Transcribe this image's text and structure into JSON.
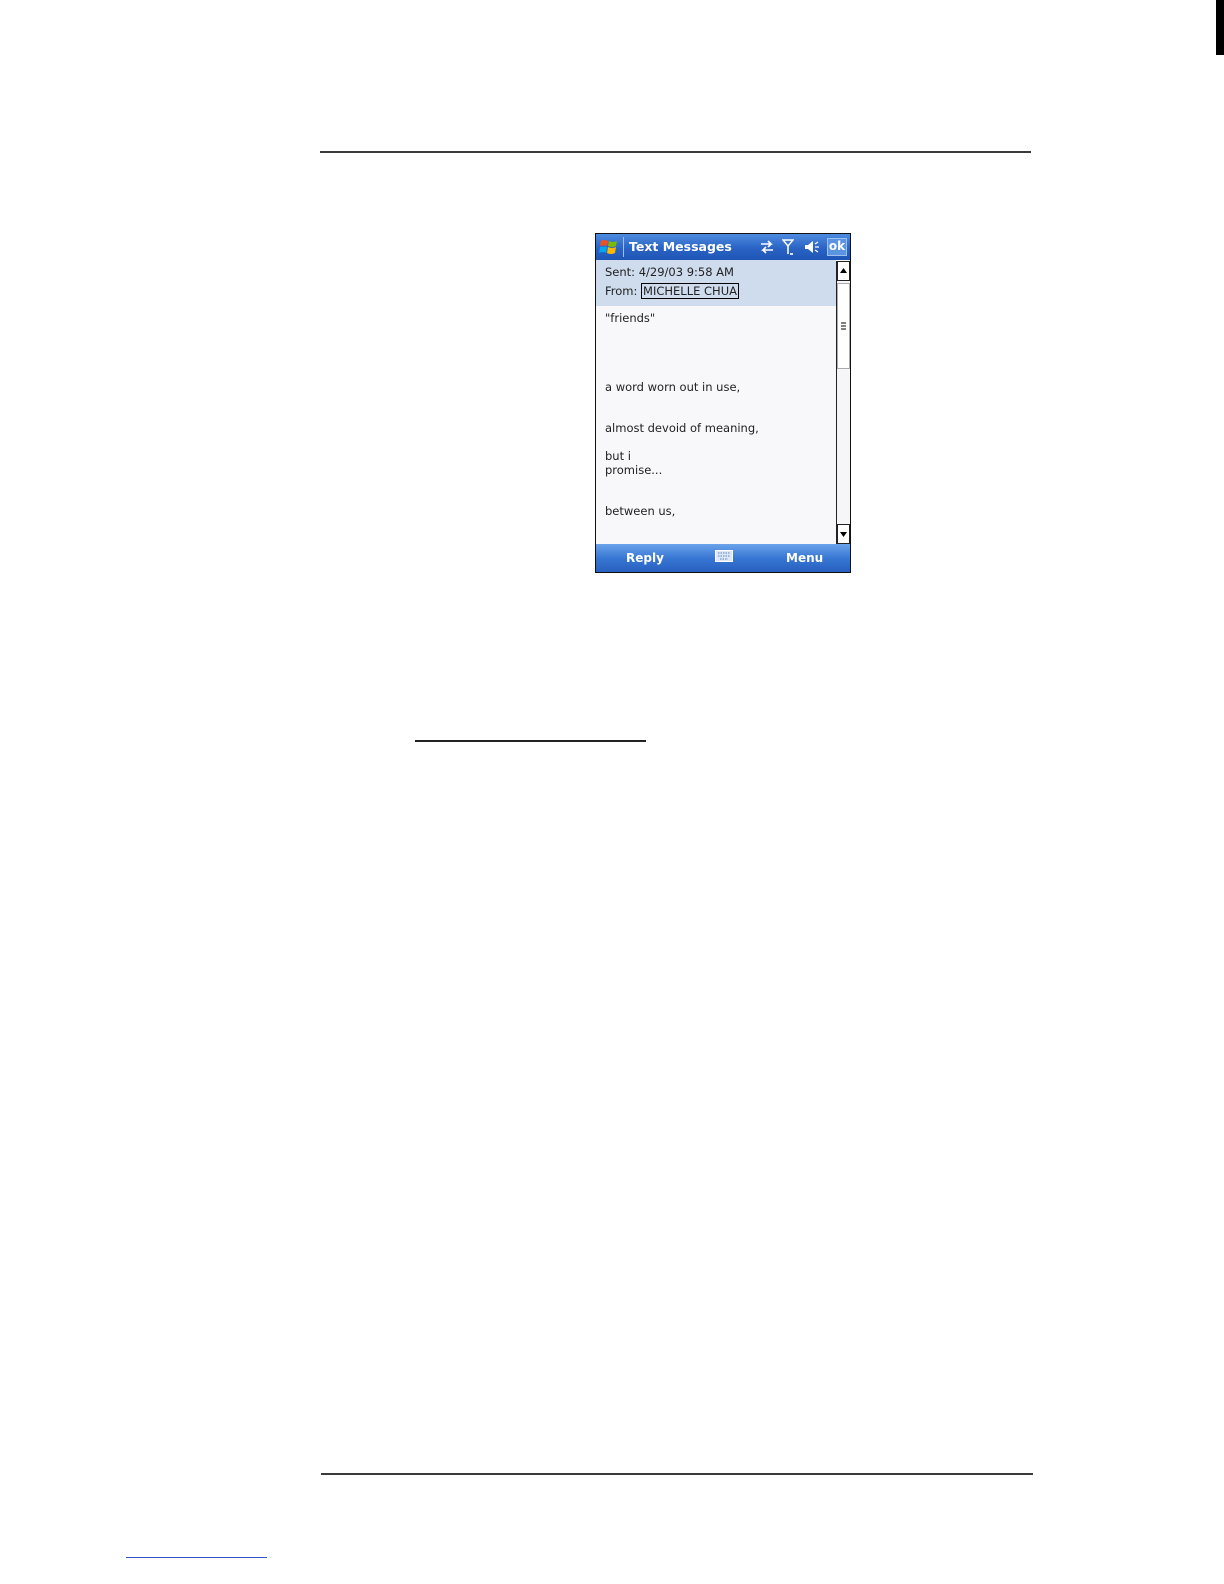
{
  "window": {
    "title": "Text Messages",
    "ok_label": "ok"
  },
  "message": {
    "sent_label": "Sent:",
    "sent_value": "4/29/03 9:58 AM",
    "from_label": "From:",
    "from_value": "MICHELLE CHUA",
    "lines": [
      "\"friends\"",
      "a word worn out in use,",
      "almost devoid of meaning,",
      "but i",
      "promise...",
      "between us,"
    ]
  },
  "menubar": {
    "left_label": "Reply",
    "right_label": "Menu"
  },
  "icons": {
    "start": "windows-flag-icon",
    "connectivity": "sync-arrows-icon",
    "signal": "antenna-signal-icon",
    "volume": "speaker-icon",
    "keyboard": "keyboard-icon"
  },
  "colors": {
    "titlebar": "#2a63c4",
    "header_bg": "#cfdcee",
    "menubar": "#3877d4"
  }
}
